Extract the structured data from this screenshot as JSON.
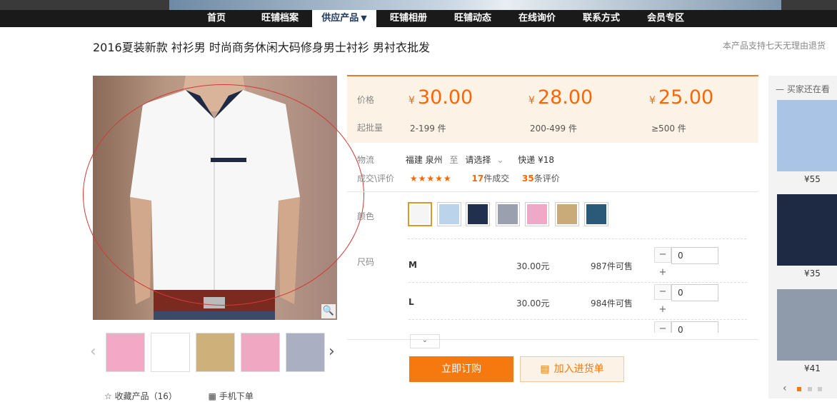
{
  "nav": {
    "items": [
      {
        "label": "首页"
      },
      {
        "label": "旺铺档案"
      },
      {
        "label": "供应产品",
        "active": true,
        "arrow": "▼"
      },
      {
        "label": "旺铺相册"
      },
      {
        "label": "旺铺动态"
      },
      {
        "label": "在线询价"
      },
      {
        "label": "联系方式"
      },
      {
        "label": "会员专区"
      }
    ]
  },
  "product": {
    "title": "2016夏装新款 衬衫男 时尚商务休闲大码修身男士衬衫 男衬衣批发",
    "notice": "本产品支持七天无理由退货"
  },
  "gallery": {
    "zoom_icon": "🔍",
    "prev": "‹",
    "next": "›",
    "thumb_colors": [
      "#f3a9c6",
      "#ffffff",
      "#cdb07a",
      "#f0a8c2",
      "#aab0c2"
    ]
  },
  "actions": {
    "collect": "☆ 收藏产品（16）",
    "mobile": "▦ 手机下单"
  },
  "pricing": {
    "price_label": "价格",
    "moq_label": "起批量",
    "currency": "¥",
    "tiers": [
      {
        "price": "30.00",
        "range": "2-199 件"
      },
      {
        "price": "28.00",
        "range": "200-499 件"
      },
      {
        "price": "25.00",
        "range": "≥500 件"
      }
    ]
  },
  "logistics": {
    "label": "物流",
    "from": "福建 泉州",
    "to_word": "至",
    "select": "请选择",
    "chevron": "⌄",
    "express": "快递 ¥18"
  },
  "reviews": {
    "label": "成交\\评价",
    "stars": "★★★★★",
    "deals_num": "17",
    "deals_text": "件成交",
    "reviews_num": "35",
    "reviews_text": "条评价"
  },
  "colors": {
    "label": "颜色",
    "swatches": [
      "#f5f5f5",
      "#bcd3ec",
      "#22304f",
      "#9aa0ad",
      "#f0a8c8",
      "#c9ab7a",
      "#2b5a78"
    ]
  },
  "sizes": {
    "label": "尺码",
    "rows": [
      {
        "name": "M",
        "price": "30.00元",
        "stock": "987件可售",
        "qty": "0"
      },
      {
        "name": "L",
        "price": "30.00元",
        "stock": "984件可售",
        "qty": "0"
      },
      {
        "name": "",
        "price": "",
        "stock": "",
        "qty": "0"
      }
    ],
    "minus": "−",
    "plus": "+"
  },
  "expand_label": "⌄",
  "buttons": {
    "buy": "立即订购",
    "cart": "加入进货单"
  },
  "side": {
    "heading": "— 买家还在看",
    "items": [
      {
        "price": "¥55",
        "color": "#a9c4e4"
      },
      {
        "price": "¥35",
        "color": "#1e2a44"
      },
      {
        "price": "¥41",
        "color": "#8f9bab"
      }
    ],
    "pager": "‹"
  }
}
